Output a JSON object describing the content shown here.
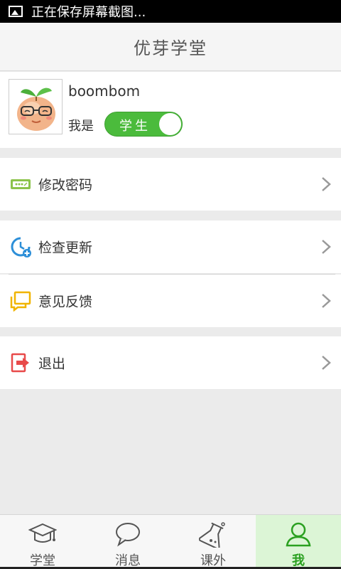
{
  "status_bar": {
    "text": "正在保存屏幕截图..."
  },
  "header": {
    "title": "优芽学堂"
  },
  "profile": {
    "username": "boombom",
    "role_label": "我是",
    "role_value": "学生"
  },
  "menu": {
    "change_password": "修改密码",
    "check_update": "检查更新",
    "feedback": "意见反馈",
    "logout": "退出"
  },
  "tabs": [
    {
      "label": "学堂",
      "icon": "graduation-cap-icon"
    },
    {
      "label": "消息",
      "icon": "chat-bubble-icon"
    },
    {
      "label": "课外",
      "icon": "flask-icon"
    },
    {
      "label": "我",
      "icon": "person-icon",
      "active": true
    }
  ],
  "colors": {
    "accent": "#4bbb3c",
    "active_tab_bg": "#dcf5d6"
  }
}
